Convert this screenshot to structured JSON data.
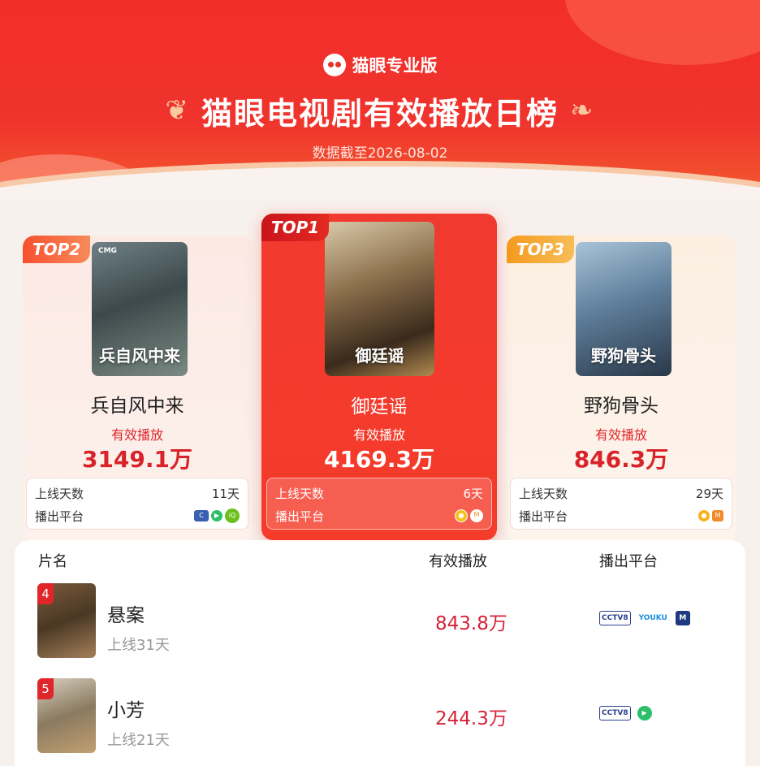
{
  "header": {
    "brand": "猫眼专业版",
    "title": "猫眼电视剧有效播放日榜",
    "date": "数据截至2026-08-02",
    "colors": {
      "primary": "#f22e2a",
      "accent": "#d8232a"
    }
  },
  "top_cards": [
    {
      "rank_label": "TOP2",
      "name": "兵自风中来",
      "poster_text": "兵自风中来",
      "poster_badge": "CMG",
      "play_label": "有效播放",
      "play_value": "3149.1万",
      "days_label": "上线天数",
      "days_value": "11天",
      "platform_label": "播出平台",
      "platform_icons": [
        "cctv-icon",
        "tencent-video-icon",
        "iqiyi-icon"
      ]
    },
    {
      "rank_label": "TOP1",
      "name": "御廷谣",
      "poster_text": "御廷谣",
      "play_label": "有效播放",
      "play_value": "4169.3万",
      "days_label": "上线天数",
      "days_value": "6天",
      "platform_label": "播出平台",
      "platform_icons": [
        "mango-tv-icon",
        "mgtv-icon"
      ]
    },
    {
      "rank_label": "TOP3",
      "name": "野狗骨头",
      "poster_text": "野狗骨头",
      "play_label": "有效播放",
      "play_value": "846.3万",
      "days_label": "上线天数",
      "days_value": "29天",
      "platform_label": "播出平台",
      "platform_icons": [
        "mango-tv-icon",
        "mgtv-icon"
      ]
    }
  ],
  "list": {
    "headers": {
      "name": "片名",
      "play": "有效播放",
      "platform": "播出平台"
    },
    "rows": [
      {
        "rank": "4",
        "name": "悬案",
        "days": "上线31天",
        "play": "843.8万",
        "platforms": [
          {
            "icon": "cctv8-icon",
            "text": "CCTV8"
          },
          {
            "icon": "youku-icon",
            "text": "YOUKU"
          },
          {
            "icon": "migu-icon",
            "text": "M"
          }
        ]
      },
      {
        "rank": "5",
        "name": "小芳",
        "days": "上线21天",
        "play": "244.3万",
        "platforms": [
          {
            "icon": "cctv8-icon",
            "text": "CCTV8"
          },
          {
            "icon": "tencent-video-icon",
            "text": ""
          }
        ]
      }
    ]
  }
}
